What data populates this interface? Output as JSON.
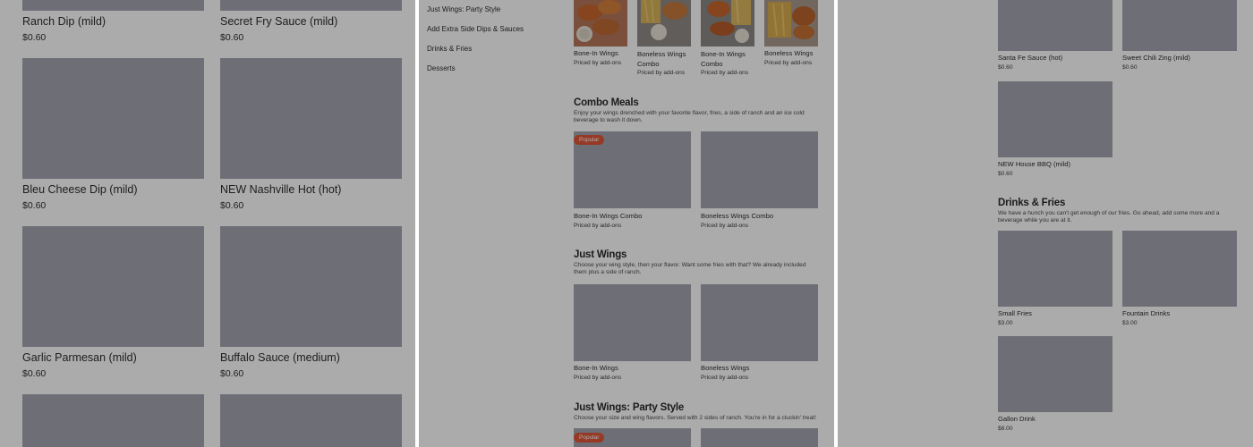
{
  "left_panel": {
    "rows": [
      {
        "items": [
          {
            "name": "Ranch Dip (mild)",
            "price": "$0.60"
          },
          {
            "name": "Secret Fry Sauce (mild)",
            "price": "$0.60"
          }
        ]
      },
      {
        "items": [
          {
            "name": "Bleu Cheese Dip (mild)",
            "price": "$0.60"
          },
          {
            "name": "NEW Nashville Hot (hot)",
            "price": "$0.60"
          }
        ]
      },
      {
        "items": [
          {
            "name": "Garlic Parmesan (mild)",
            "price": "$0.60"
          },
          {
            "name": "Buffalo Sauce (medium)",
            "price": "$0.60"
          }
        ]
      }
    ]
  },
  "middle_panel": {
    "categories": [
      "Just Wings: Party Style",
      "Add Extra Side Dips & Sauces",
      "Drinks & Fries",
      "Desserts"
    ],
    "featured": [
      {
        "name": "Bone-In Wings",
        "sub": "Priced by add-ons"
      },
      {
        "name": "Boneless Wings Combo",
        "sub": "Priced by add-ons"
      },
      {
        "name": "Bone-In Wings Combo",
        "sub": "Priced by add-ons"
      },
      {
        "name": "Boneless Wings",
        "sub": "Priced by add-ons"
      }
    ],
    "sections": [
      {
        "title": "Combo Meals",
        "description": "Enjoy your wings drenched with your favorite flavor, fries, a side of ranch and an ice cold beverage to wash it down.",
        "items": [
          {
            "name": "Bone-In Wings Combo",
            "sub": "Priced by add-ons",
            "badge": "Popular"
          },
          {
            "name": "Boneless Wings Combo",
            "sub": "Priced by add-ons"
          }
        ]
      },
      {
        "title": "Just Wings",
        "description": "Choose your wing style, then your flavor. Want some fries with that? We already included them plus a side of ranch.",
        "items": [
          {
            "name": "Bone-In Wings",
            "sub": "Priced by add-ons"
          },
          {
            "name": "Boneless Wings",
            "sub": "Priced by add-ons"
          }
        ]
      },
      {
        "title": "Just Wings: Party Style",
        "description": "Choose your size and wing flavors. Served with 2 sides of ranch. You're in for a cluckin' treat!",
        "items": [
          {
            "badge": "Popular"
          }
        ]
      }
    ]
  },
  "right_panel": {
    "sauces": [
      {
        "name": "Santa Fe Sauce (hot)",
        "price": "$0.60"
      },
      {
        "name": "Sweet Chili Zing (mild)",
        "price": "$0.60"
      },
      {
        "name": "NEW House BBQ (mild)",
        "price": "$0.60"
      }
    ],
    "drinks_section": {
      "title": "Drinks & Fries",
      "description": "We have a hunch you can't get enough of our fries. Go ahead, add some more and a beverage while you are at it.",
      "items": [
        {
          "name": "Small Fries",
          "price": "$3.00"
        },
        {
          "name": "Fountain Drinks",
          "price": "$3.00"
        },
        {
          "name": "Gallon Drink",
          "price": "$8.00"
        }
      ]
    }
  },
  "colors": {
    "placeholder": "#a4a6b0",
    "badge": "#e0573a",
    "overlay": "rgba(0,0,0,0.33)"
  }
}
